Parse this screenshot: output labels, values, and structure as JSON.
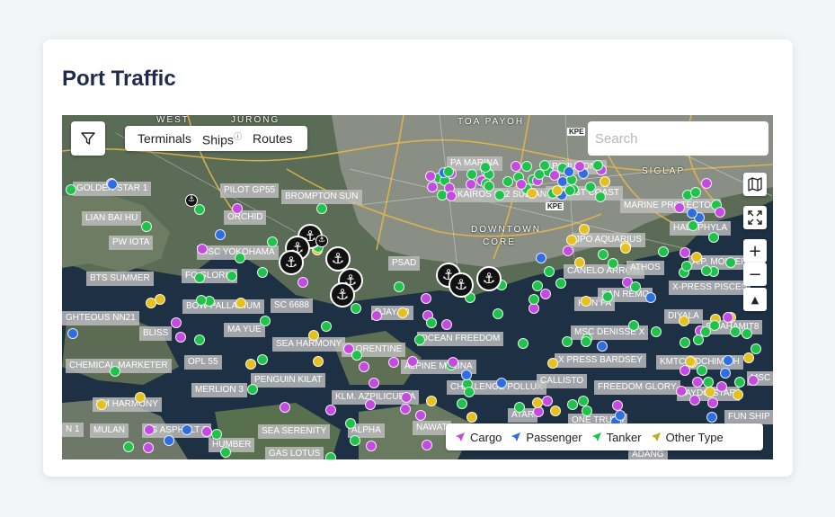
{
  "card": {
    "title": "Port Traffic"
  },
  "layers": {
    "terminals": "Terminals",
    "ships": "Ships",
    "routes": "Routes"
  },
  "search": {
    "placeholder": "Search"
  },
  "controls": {
    "zoom_in": "+",
    "zoom_out": "−",
    "north": "▲"
  },
  "legend": [
    {
      "label": "Cargo",
      "color": "#c44be0"
    },
    {
      "label": "Passenger",
      "color": "#2f6ee0"
    },
    {
      "label": "Tanker",
      "color": "#1fc24a"
    },
    {
      "label": "Other Type",
      "color": "#c9a81f"
    }
  ],
  "map_places": [
    "WEST",
    "JURONG",
    "TOA PAYOH",
    "SIGLAP",
    "DOWNTOWN",
    "CORE",
    "KPE",
    "KPE"
  ],
  "vessel_labels": [
    "GOLDEN STAR 1",
    "PILOT GP55",
    "BROMPTON SUN",
    "LIAN BAI HU",
    "ORCHID",
    "PW IOTA",
    "MSC YOKOHAMA",
    "FC GLORIA",
    "BTS SUMMER",
    "BOW PALLADIUM",
    "SC 6688",
    "GHTEOUS NN21",
    "BLISS",
    "MA YUE",
    "SEA HARMONY",
    "CHEMICAL MARKETER",
    "OPL 55",
    "MERLION 3",
    "PENGUIN KILAT",
    "YM HARMONY",
    "KLM. AZPILICUETA",
    "MULAN",
    "LG ASPHALT 2",
    "HUMBER",
    "SEA SERENITY",
    "GAS LOTUS",
    "ALPHA",
    "NAWAT",
    "PA MARINA",
    "PA JURONG",
    "KAIROS S12 SULTAN",
    "PA EAST COAST",
    "PSAD",
    "DJAYA 3",
    "FLORENTINE",
    "OCEAN FREEDOM",
    "ALPINE MELINA",
    "CHALLENGE POLLUX",
    "CALLISTO",
    "JPO AQUARIUS",
    "CANELO ARROW",
    "ATHOS",
    "SAN REMO",
    "HON FA",
    "MSC DENISSE X",
    "X PRESS BARDSEY",
    "FREEDOM GLORY",
    "ATAR",
    "ONE TRUTH",
    "ADANG",
    "MARINE PROTECTOR",
    "HALOPHYLA",
    "A.P. MOLLER",
    "X-PRESS PISCES",
    "DIYALA",
    "S.SAHAMIT8",
    "KMTC HOCHIMINH",
    "TAYDO STAR",
    "FUN SHIP",
    "MSC",
    "KO",
    "N 1"
  ]
}
